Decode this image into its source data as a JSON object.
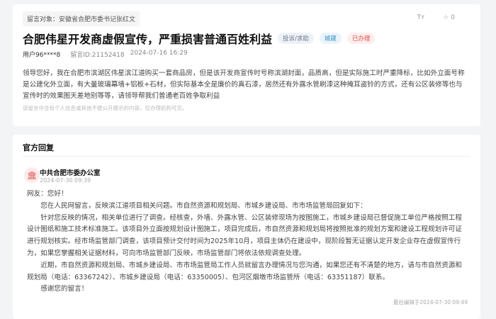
{
  "post": {
    "target": "留言对象：安徽省合肥市委书记张红文",
    "font_tool": "Tт",
    "star_count": "☆ 0",
    "title": "合肥伟星开发商虚假宣传，严重损害普通百姓利益",
    "tags": [
      "投诉/求助",
      "城建",
      "已办理"
    ],
    "user": "用户96****8",
    "message_id": "留言ID:21152418",
    "time": "2024-07-16 16:29",
    "body": "领导您好，我在合肥市滨湖区伟星滨江道购买一套商品房，但是该开发商宣传时号称滨湖封面，品质高，但是实际施工时严重降标，比如外立面号称是公建化外立面，有大量玻璃幕墙+铝板+石材，但实际基本全是廉价的真石漆，居然还有外露水管刷漆这种掩耳盗铃的方式，还有公区装修等也与宣传时的效果图天差地别等等，请领导帮我们普通老百姓争取利益",
    "privacy_note": "该留言中含有个人信息或其他不便公开展示的内容，仅办理机构可见。"
  },
  "reply": {
    "section_title": "官方回复",
    "org_icon": "government-building-icon",
    "org": "中共合肥市委办公室",
    "time": "2024-07-30 09:39",
    "greeting": "网友：您好！",
    "paragraphs": [
      "您在人民网留言，反映滨江道项目相关问题。市自然资源和规划局、市城乡建设局、市市场监管局回复如下：",
      "针对您反映的情况，相关单位进行了调查。经核查，外墙、外露水管、公区装修现场为按图施工，市城乡建设局已督促施工单位严格按照工程设计图纸和施工技术标准施工。该项目外立面按规划设计图施工，项目完成后，市自然资源和规划局将按照批准的规划方案和建设工程规划许可证进行规划核实。经市场监管部门调查，该项目预计交付时间为2025年10月，项目主体仍在建设中，现阶段暂无证据认定开发企业存在虚假宣传行为，如果您掌握相关证据材料，可向市场监管部门反映，市场监管部门将依法依规调查处理。",
      "近期，市自然资源和规划局、市城乡建设局、市市场监管局工作人员就留言办理情况与您沟通，如果您还有不清楚的地方，请与市自然资源和规划局（电话：63367242）、市城乡建设局（电话：63350005）、包河区烟墩市场监管所（电话：63351187）联系。",
      "感谢您的留言！"
    ],
    "last_edited": "最后编辑于2024-07-30 09:49"
  }
}
